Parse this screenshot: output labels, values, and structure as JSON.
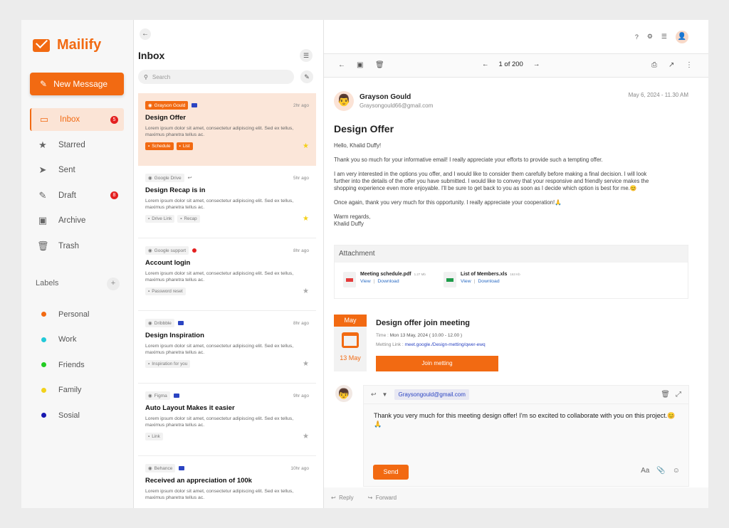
{
  "app": {
    "name": "Mailify"
  },
  "sidebar": {
    "new_message": "New Message",
    "nav": [
      {
        "label": "Inbox",
        "icon": "inbox-icon",
        "glyph": "▭",
        "badge": "5",
        "active": true
      },
      {
        "label": "Starred",
        "icon": "star-icon",
        "glyph": "★",
        "badge": ""
      },
      {
        "label": "Sent",
        "icon": "send-icon",
        "glyph": "➤",
        "badge": ""
      },
      {
        "label": "Draft",
        "icon": "pencil-icon",
        "glyph": "✎",
        "badge": "8"
      },
      {
        "label": "Archive",
        "icon": "archive-icon",
        "glyph": "▣",
        "badge": ""
      },
      {
        "label": "Trash",
        "icon": "trash-icon",
        "glyph": "🗑",
        "badge": ""
      }
    ],
    "labels_title": "Labels",
    "labels": [
      {
        "name": "Personal",
        "color": "#f26a12"
      },
      {
        "name": "Work",
        "color": "#22c9d8"
      },
      {
        "name": "Friends",
        "color": "#22cc22"
      },
      {
        "name": "Family",
        "color": "#f2d21c"
      },
      {
        "name": "Sosial",
        "color": "#1818b0"
      }
    ]
  },
  "list": {
    "title": "Inbox",
    "search_placeholder": "Search",
    "mails": [
      {
        "source": "Grayson Gould",
        "time": "2hr ago",
        "subject": "Design Offer",
        "preview": "Lorem ipsum dolor sit amet, consectetur adipiscing elit. Sed ex tellus, maximus pharetra tellus ac.",
        "tags": [
          "Schedule",
          "List"
        ],
        "starred": true
      },
      {
        "source": "Google Drive",
        "time": "5hr ago",
        "subject": "Design Recap is in",
        "preview": "Lorem ipsum dolor sit amet, consectetur adipiscing elit. Sed ex tellus, maximus pharetra tellus ac.",
        "tags": [
          "Drive Link",
          "Recap"
        ],
        "starred": true
      },
      {
        "source": "Google support",
        "time": "8hr ago",
        "subject": "Account login",
        "preview": "Lorem ipsum dolor sit amet, consectetur adipiscing elit. Sed ex tellus, maximus pharetra tellus ac.",
        "tags": [
          "Password reset"
        ],
        "starred": false
      },
      {
        "source": "Dribbble",
        "time": "8hr ago",
        "subject": "Design Inspiration",
        "preview": "Lorem ipsum dolor sit amet, consectetur adipiscing elit. Sed ex tellus, maximus pharetra tellus ac.",
        "tags": [
          "Inspiration for you"
        ],
        "starred": false
      },
      {
        "source": "Figma",
        "time": "9hr ago",
        "subject": "Auto Layout Makes it easier",
        "preview": "Lorem ipsum dolor sit amet, consectetur adipiscing elit. Sed ex tellus, maximus pharetra tellus ac.",
        "tags": [
          "Link"
        ],
        "starred": false
      },
      {
        "source": "Behance",
        "time": "10hr ago",
        "subject": "Received an appreciation of 100k",
        "preview": "Lorem ipsum dolor sit amet, consectetur adipiscing elit. Sed ex tellus, maximus pharetra tellus ac.",
        "tags": [],
        "starred": false
      }
    ]
  },
  "reader": {
    "pager": "1 of 200",
    "sender_name": "Grayson Gould",
    "sender_email": "Graysongould66@gmail.com",
    "date": "May 6, 2024 - 11.30 AM",
    "title": "Design Offer",
    "greeting": "Hello, Khalid Duffy!",
    "p1": "Thank you so much for your informative email! I really appreciate your efforts to provide such a tempting offer.",
    "p2": "I am very interested in the options you offer, and I would like to consider them carefully before making a final decision. I will look further into the details of the offer you have submitted. I would like to convey that your responsive and friendly service makes the shopping experience even more enjoyable. I'll be sure to get back to you as soon as I decide which option is best for me.😊",
    "p3": "Once again, thank you very much for this opportunity. I really appreciate your cooperation!🙏",
    "signoff": "Warm regards,",
    "signname": "Khalid Duffy",
    "attachment_title": "Attachment",
    "files": [
      {
        "name": "Meeting schedule.pdf",
        "size": "1.27 Mb",
        "view": "View",
        "download": "Download",
        "color": "#e43b3b"
      },
      {
        "name": "List of Members.xls",
        "size": "163 Kb",
        "view": "View",
        "download": "Download",
        "color": "#1e9b4a"
      }
    ],
    "calendar_month": "May",
    "calendar_date": "13 May",
    "meeting_title": "Design offer join meeting",
    "meeting_time_label": "Time :",
    "meeting_time": "Mon 13 May, 2024 ( 10.00 - 12.00 )",
    "meeting_link_label": "Metting Link :",
    "meeting_link": "meet.google./Design-metting/qwer-ewq",
    "join_label": "Join metting",
    "reply_to": "Graysongould@gmail.com",
    "reply_text": "Thank you very much for this meeting design offer! I'm so excited to collaborate with you on this project.😊🙏",
    "send_label": "Send",
    "font_tool": "Aa",
    "reply_label": "Reply",
    "forward_label": "Forward"
  }
}
